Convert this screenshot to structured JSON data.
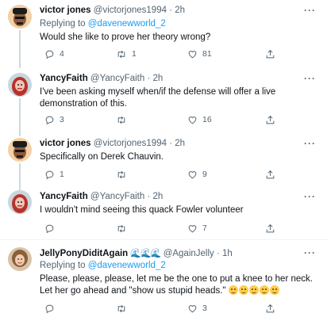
{
  "tweets": [
    {
      "name": "victor jones",
      "handle": "@victorjones1994",
      "time": "2h",
      "reply_prefix": "Replying to",
      "reply_to": "@davenewworld_2",
      "text": "Would she like to prove her theory wrong?",
      "replies": "4",
      "retweets": "1",
      "likes": "81"
    },
    {
      "name": "YancyFaith",
      "handle": "@YancyFaith",
      "time": "2h",
      "text": "I've been asking myself when/if the defense will offer a live demonstration of this.",
      "replies": "3",
      "retweets": "",
      "likes": "16"
    },
    {
      "name": "victor jones",
      "handle": "@victorjones1994",
      "time": "2h",
      "text": "Specifically on Derek Chauvin.",
      "replies": "1",
      "retweets": "",
      "likes": "9"
    },
    {
      "name": "YancyFaith",
      "handle": "@YancyFaith",
      "time": "2h",
      "text": "I wouldn't mind seeing this quack Fowler volunteer",
      "replies": "",
      "retweets": "",
      "likes": "7"
    },
    {
      "name": "JellyPonyDiditAgain",
      "name_emoji": "🌊🌊🌊",
      "handle": "@AgainJelly",
      "time": "1h",
      "reply_prefix": "Replying to",
      "reply_to": "@davenewworld_2",
      "text": "Please, please, please, let me be the one to put a knee to her neck. Let her go ahead and \"show us stupid heads.\"",
      "emoji_icon": "grinning-face-emoji",
      "replies": "",
      "retweets": "",
      "likes": "3"
    }
  ],
  "separator": "·",
  "more_icon": "more-dots-icon",
  "colors": {
    "link": "#1d9bf0",
    "secondary": "#536471",
    "thread_line": "#cfd9de"
  }
}
